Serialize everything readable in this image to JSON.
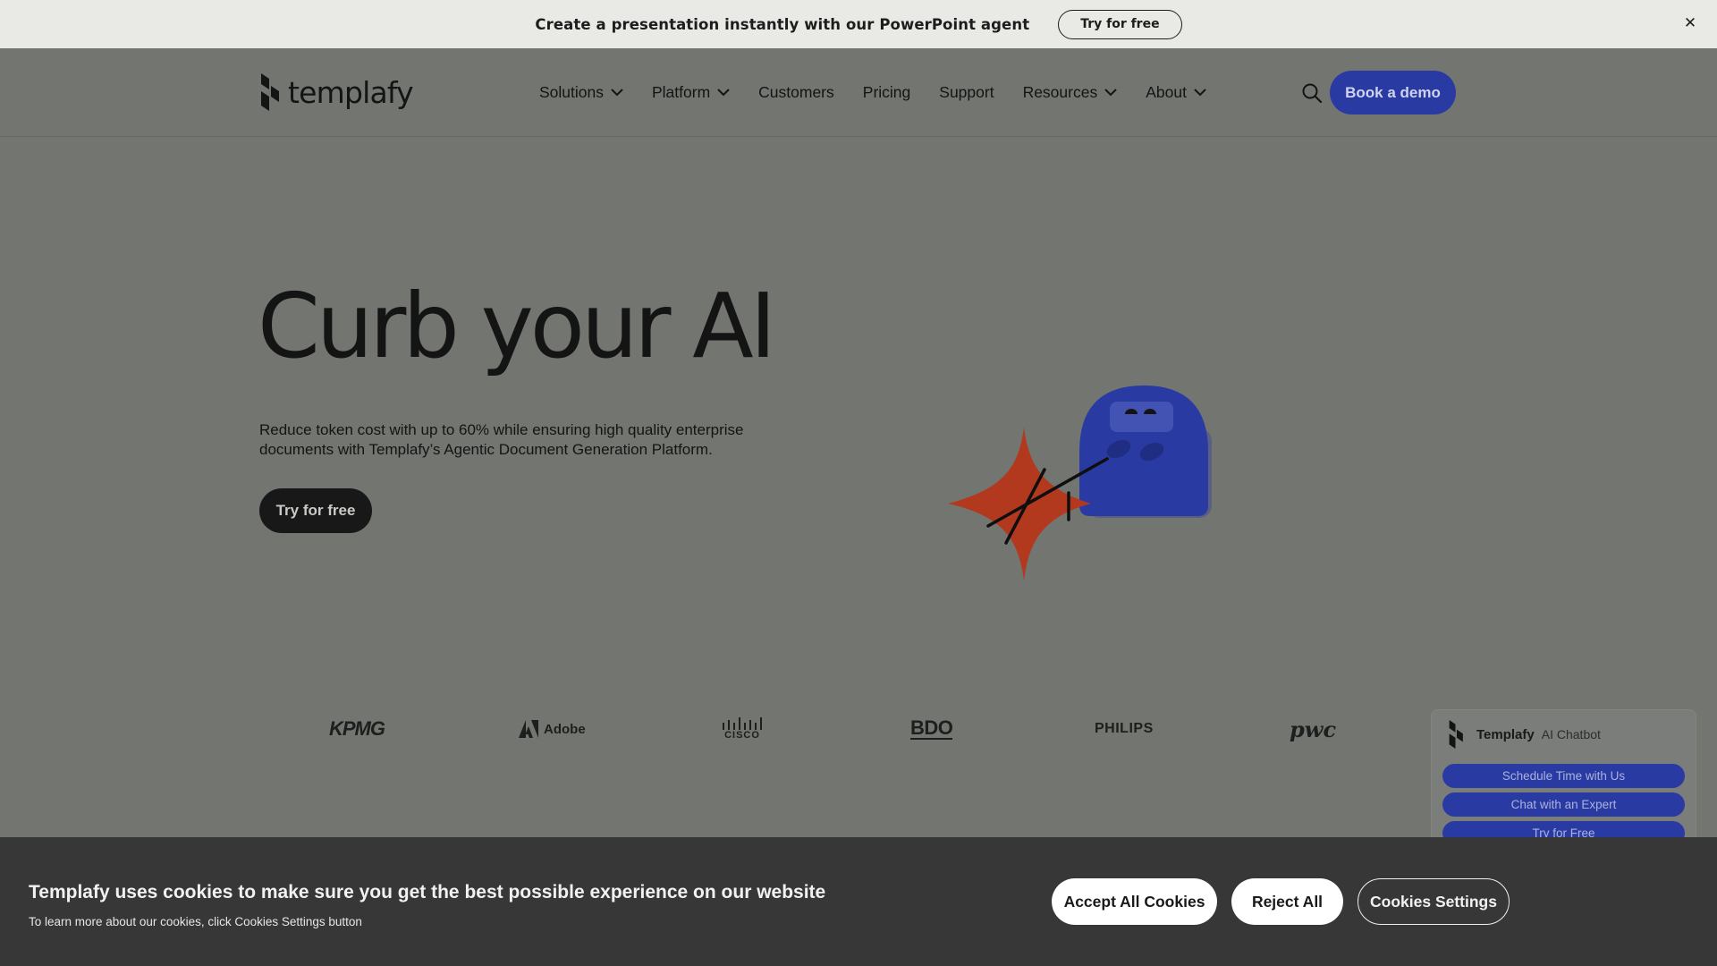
{
  "announcement": {
    "text": "Create a presentation instantly with our PowerPoint agent",
    "cta": "Try for free",
    "close_glyph": "✕"
  },
  "nav": {
    "logo_text": "templafy",
    "items": [
      {
        "label": "Solutions",
        "has_dropdown": true
      },
      {
        "label": "Platform",
        "has_dropdown": true
      },
      {
        "label": "Customers",
        "has_dropdown": false
      },
      {
        "label": "Pricing",
        "has_dropdown": false
      },
      {
        "label": "Support",
        "has_dropdown": false
      },
      {
        "label": "Resources",
        "has_dropdown": true
      },
      {
        "label": "About",
        "has_dropdown": true
      }
    ],
    "search_icon": "search-icon",
    "demo_label": "Book a demo"
  },
  "hero": {
    "title": "Curb your AI",
    "subtitle": "Reduce token cost with up to 60% while ensuring high quality enterprise documents with Templafy’s Agentic Document Generation Platform.",
    "cta": "Try for free"
  },
  "brands": {
    "kpmg": "KPMG",
    "adobe": "Adobe",
    "cisco": "CISCO",
    "bdo": "BDO",
    "philips": "PHILIPS",
    "pwc": "pwc"
  },
  "chatbot": {
    "brand": "Templafy",
    "tag": "AI Chatbot",
    "buttons": [
      "Schedule Time with Us",
      "Chat with an Expert",
      "Try for Free"
    ]
  },
  "cookie": {
    "title": "Templafy uses cookies to make sure you get the best possible experience on our website",
    "subtitle": "To learn more about our cookies, click Cookies Settings button",
    "accept": "Accept All Cookies",
    "reject": "Reject All",
    "settings": "Cookies Settings"
  },
  "colors": {
    "page_bg": "#727570",
    "accent_blue": "#2a3aa3",
    "announce_bg": "#e9eae5",
    "cookie_bg": "#373737",
    "star_red": "#b2391e"
  }
}
